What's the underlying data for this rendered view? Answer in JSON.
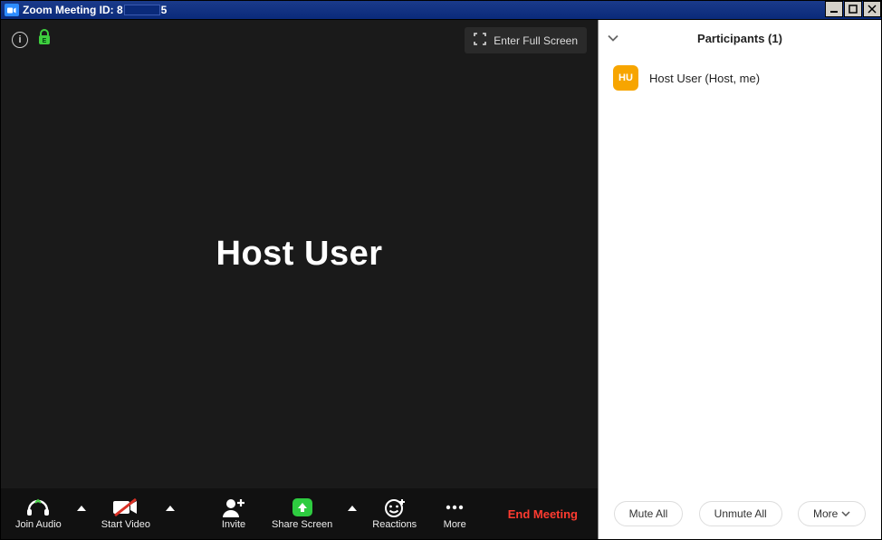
{
  "titlebar": {
    "prefix": "Zoom Meeting ID: 8",
    "suffix": "5"
  },
  "stage": {
    "center_name": "Host User",
    "full_screen_label": "Enter Full Screen"
  },
  "toolbar": {
    "join_audio": "Join Audio",
    "start_video": "Start Video",
    "invite": "Invite",
    "share_screen": "Share Screen",
    "reactions": "Reactions",
    "more": "More",
    "end_meeting": "End Meeting"
  },
  "participants": {
    "header": "Participants (1)",
    "items": [
      {
        "initials": "HU",
        "name": "Host User (Host, me)"
      }
    ],
    "mute_all": "Mute All",
    "unmute_all": "Unmute All",
    "more": "More"
  }
}
